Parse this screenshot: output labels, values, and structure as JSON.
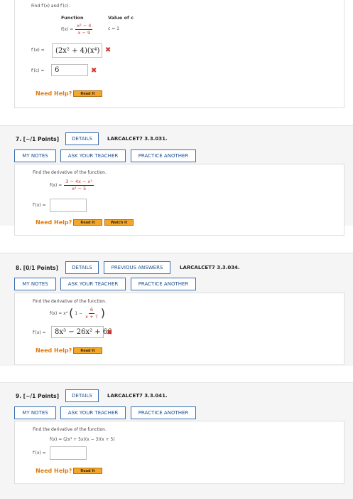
{
  "q6": {
    "prompt": "Find f′(x) and f′(c).",
    "function_header": "Function",
    "value_header": "Value of c",
    "f_label": "f(x) =",
    "f_num": "x² − 4",
    "f_den": "x − 9",
    "c_value": "c = 1",
    "fprime_label": "f′(x) =",
    "fprime_answer": "(2x² + 4)(x⁴)",
    "fprime_c_label": "f′(c) =",
    "fprime_c_answer": "6",
    "need_help": "Need Help?",
    "read_it": "Read It"
  },
  "q7": {
    "header": "7. [−/1 Points]",
    "details": "DETAILS",
    "code": "LARCALCET7 3.3.031.",
    "my_notes": "MY NOTES",
    "ask_teacher": "ASK YOUR TEACHER",
    "practice": "PRACTICE ANOTHER",
    "prompt": "Find the derivative of the function.",
    "f_label": "f(x) =",
    "f_num": "3 − 4x − x²",
    "f_den": "x² − 5",
    "fprime_label": "f′(x) =",
    "fprime_answer": "",
    "need_help": "Need Help?",
    "read_it": "Read It",
    "watch_it": "Watch It"
  },
  "q8": {
    "header": "8. [0/1 Points]",
    "details": "DETAILS",
    "previous": "PREVIOUS ANSWERS",
    "code": "LARCALCET7 3.3.034.",
    "my_notes": "MY NOTES",
    "ask_teacher": "ASK YOUR TEACHER",
    "practice": "PRACTICE ANOTHER",
    "prompt": "Find the derivative of the function.",
    "f_label": "f(x) = x⁴",
    "f_inner": "1 −",
    "f_num": "6",
    "f_den": "x + 7",
    "fprime_label": "f′(x) =",
    "fprime_answer": "8x³ − 26x² + 66",
    "need_help": "Need Help?",
    "read_it": "Read It"
  },
  "q9": {
    "header": "9. [−/1 Points]",
    "details": "DETAILS",
    "code": "LARCALCET7 3.3.041.",
    "my_notes": "MY NOTES",
    "ask_teacher": "ASK YOUR TEACHER",
    "practice": "PRACTICE ANOTHER",
    "prompt": "Find the derivative of the function.",
    "f_label": "f(x) = (2x³ + 5x)(x − 3)(x + 5)",
    "fprime_label": "f′(x) =",
    "fprime_answer": "",
    "need_help": "Need Help?",
    "read_it": "Read It"
  },
  "colors": {
    "accent_blue": "#1e4f8f",
    "need_help_orange": "#e07a10",
    "wrong_red": "#d0342c",
    "math_red": "#c0392b"
  },
  "icons": {
    "wrong": "x-mark-icon"
  }
}
